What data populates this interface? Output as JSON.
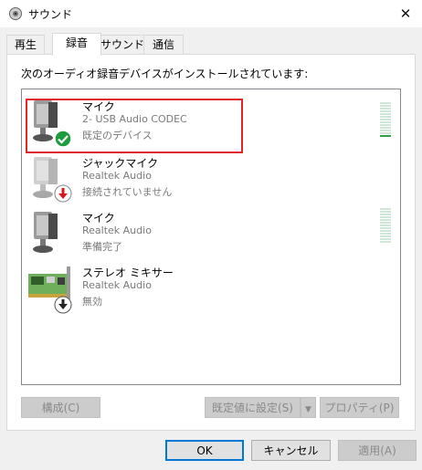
{
  "window": {
    "title": "サウンド",
    "close_glyph": "✕"
  },
  "tabs": [
    {
      "label": "再生"
    },
    {
      "label": "録音"
    },
    {
      "label": "サウンド"
    },
    {
      "label": "通信"
    }
  ],
  "instructions": "次のオーディオ録音デバイスがインストールされています:",
  "devices": [
    {
      "name": "マイク",
      "driver": "2- USB Audio CODEC",
      "status": "既定のデバイス",
      "icon": "microphone-icon",
      "badge": "default-check-icon"
    },
    {
      "name": "ジャックマイク",
      "driver": "Realtek Audio",
      "status": "接続されていません",
      "icon": "microphone-icon",
      "badge": "unplugged-icon"
    },
    {
      "name": "マイク",
      "driver": "Realtek Audio",
      "status": "準備完了",
      "icon": "microphone-icon",
      "badge": null
    },
    {
      "name": "ステレオ ミキサー",
      "driver": "Realtek Audio",
      "status": "無効",
      "icon": "sound-card-icon",
      "badge": "disabled-icon"
    }
  ],
  "buttons": {
    "configure": "構成(C)",
    "set_default": "既定値に設定(S)",
    "properties": "プロパティ(P)",
    "ok": "OK",
    "cancel": "キャンセル",
    "apply": "適用(A)"
  },
  "colors": {
    "selection_border": "#e0262a",
    "check_green": "#1e9b3c",
    "error_red": "#d9181b",
    "meter_green": "#2ea043"
  }
}
